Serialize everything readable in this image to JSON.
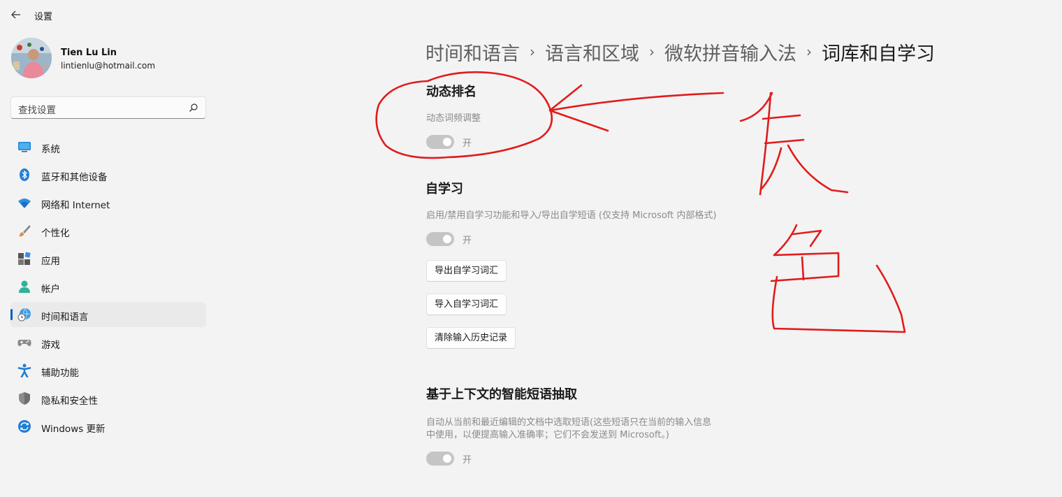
{
  "app": {
    "title": "设置"
  },
  "user": {
    "name": "Tien Lu Lin",
    "email": "lintienlu@hotmail.com"
  },
  "search": {
    "placeholder": "查找设置"
  },
  "nav": {
    "items": [
      {
        "label": "系统",
        "icon": "system-icon"
      },
      {
        "label": "蓝牙和其他设备",
        "icon": "bluetooth-icon"
      },
      {
        "label": "网络和 Internet",
        "icon": "wifi-icon"
      },
      {
        "label": "个性化",
        "icon": "brush-icon"
      },
      {
        "label": "应用",
        "icon": "apps-icon"
      },
      {
        "label": "帐户",
        "icon": "account-icon"
      },
      {
        "label": "时间和语言",
        "icon": "time-language-icon",
        "active": true
      },
      {
        "label": "游戏",
        "icon": "gamepad-icon"
      },
      {
        "label": "辅助功能",
        "icon": "accessibility-icon"
      },
      {
        "label": "隐私和安全性",
        "icon": "shield-icon"
      },
      {
        "label": "Windows 更新",
        "icon": "update-icon"
      }
    ]
  },
  "breadcrumb": [
    "时间和语言",
    "语言和区域",
    "微软拼音输入法",
    "词库和自学习"
  ],
  "sections": {
    "dynamic_rank": {
      "title": "动态排名",
      "desc": "动态词频调整",
      "toggle_label": "开"
    },
    "self_learning": {
      "title": "自学习",
      "desc": "启用/禁用自学习功能和导入/导出自学短语 (仅支持 Microsoft 内部格式)",
      "toggle_label": "开",
      "buttons": {
        "export": "导出自学习词汇",
        "import": "导入自学习词汇",
        "clear": "清除输入历史记录"
      }
    },
    "context_phrase": {
      "title": "基于上下文的智能短语抽取",
      "desc_line1": "自动从当前和最近编辑的文档中选取短语(这些短语只在当前的输入信息",
      "desc_line2": "中使用，以便提高输入准确率；它们不会发送到 Microsoft。)",
      "toggle_label": "开"
    }
  },
  "colors": {
    "accent": "#005fb8",
    "annotation": "#e21b1b",
    "toggle_off": "#c5c5c5"
  }
}
